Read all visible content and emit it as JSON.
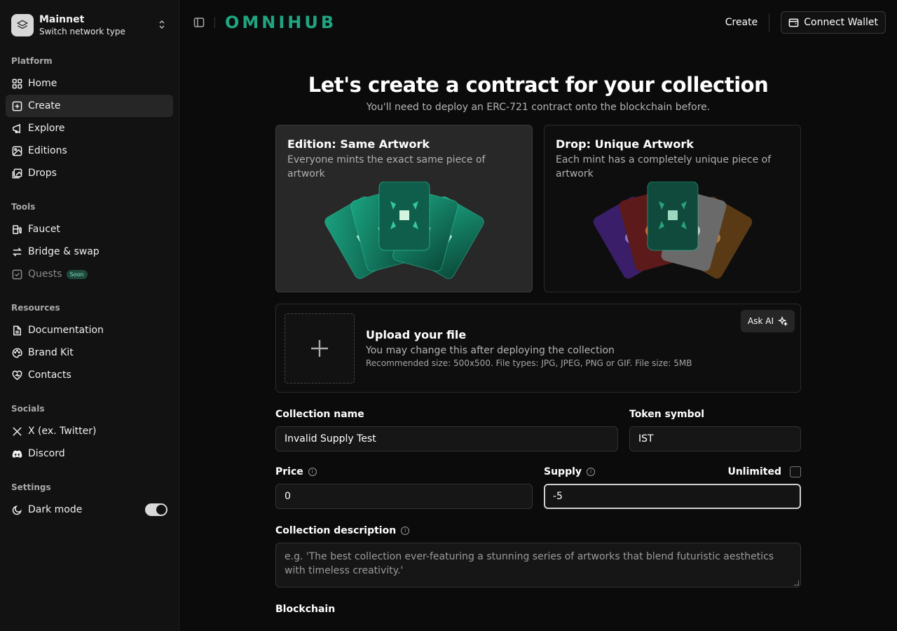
{
  "network": {
    "title": "Mainnet",
    "subtitle": "Switch network type"
  },
  "sidebar": {
    "platform_label": "Platform",
    "platform": [
      {
        "label": "Home",
        "icon": "grid-icon"
      },
      {
        "label": "Create",
        "icon": "plus-square-icon"
      },
      {
        "label": "Explore",
        "icon": "megaphone-icon"
      },
      {
        "label": "Editions",
        "icon": "image-icon"
      },
      {
        "label": "Drops",
        "icon": "images-icon"
      }
    ],
    "tools_label": "Tools",
    "tools": [
      {
        "label": "Faucet",
        "icon": "fuel-icon"
      },
      {
        "label": "Bridge & swap",
        "icon": "arrows-icon"
      },
      {
        "label": "Quests",
        "icon": "check-square-icon",
        "badge": "Soon"
      }
    ],
    "resources_label": "Resources",
    "resources": [
      {
        "label": "Documentation",
        "icon": "file-icon"
      },
      {
        "label": "Brand Kit",
        "icon": "palette-icon"
      },
      {
        "label": "Contacts",
        "icon": "heart-icon"
      }
    ],
    "socials_label": "Socials",
    "socials": [
      {
        "label": "X (ex. Twitter)",
        "icon": "x-icon"
      },
      {
        "label": "Discord",
        "icon": "discord-icon"
      }
    ],
    "settings_label": "Settings",
    "dark_mode_label": "Dark mode"
  },
  "topbar": {
    "logo": "OMNIHUB",
    "create_label": "Create",
    "wallet_label": "Connect Wallet"
  },
  "page": {
    "title": "Let's create a contract for your collection",
    "subtitle": "You'll need to deploy an ERC-721 contract onto the blockchain before."
  },
  "cards": [
    {
      "title": "Edition: Same Artwork",
      "desc": "Everyone mints the exact same piece of artwork"
    },
    {
      "title": "Drop: Unique Artwork",
      "desc": "Each mint has a completely unique piece of artwork"
    }
  ],
  "upload": {
    "title": "Upload your file",
    "subtitle": "You may change this after deploying the collection",
    "note": "Recommended size: 500x500. File types: JPG, JPEG, PNG or GIF. File size: 5MB",
    "ask_ai": "Ask AI"
  },
  "form": {
    "collection_name_label": "Collection name",
    "collection_name_value": "Invalid Supply Test",
    "token_symbol_label": "Token symbol",
    "token_symbol_value": "IST",
    "price_label": "Price",
    "price_value": "0",
    "supply_label": "Supply",
    "supply_value": "-5",
    "unlimited_label": "Unlimited",
    "description_label": "Collection description",
    "description_placeholder": "e.g. 'The best collection ever-featuring a stunning series of artworks that blend futuristic aesthetics with timeless creativity.'",
    "blockchain_label": "Blockchain"
  },
  "colors": {
    "accent": "#1fa580",
    "background": "#0b0b0b",
    "sidebar": "#121212"
  }
}
